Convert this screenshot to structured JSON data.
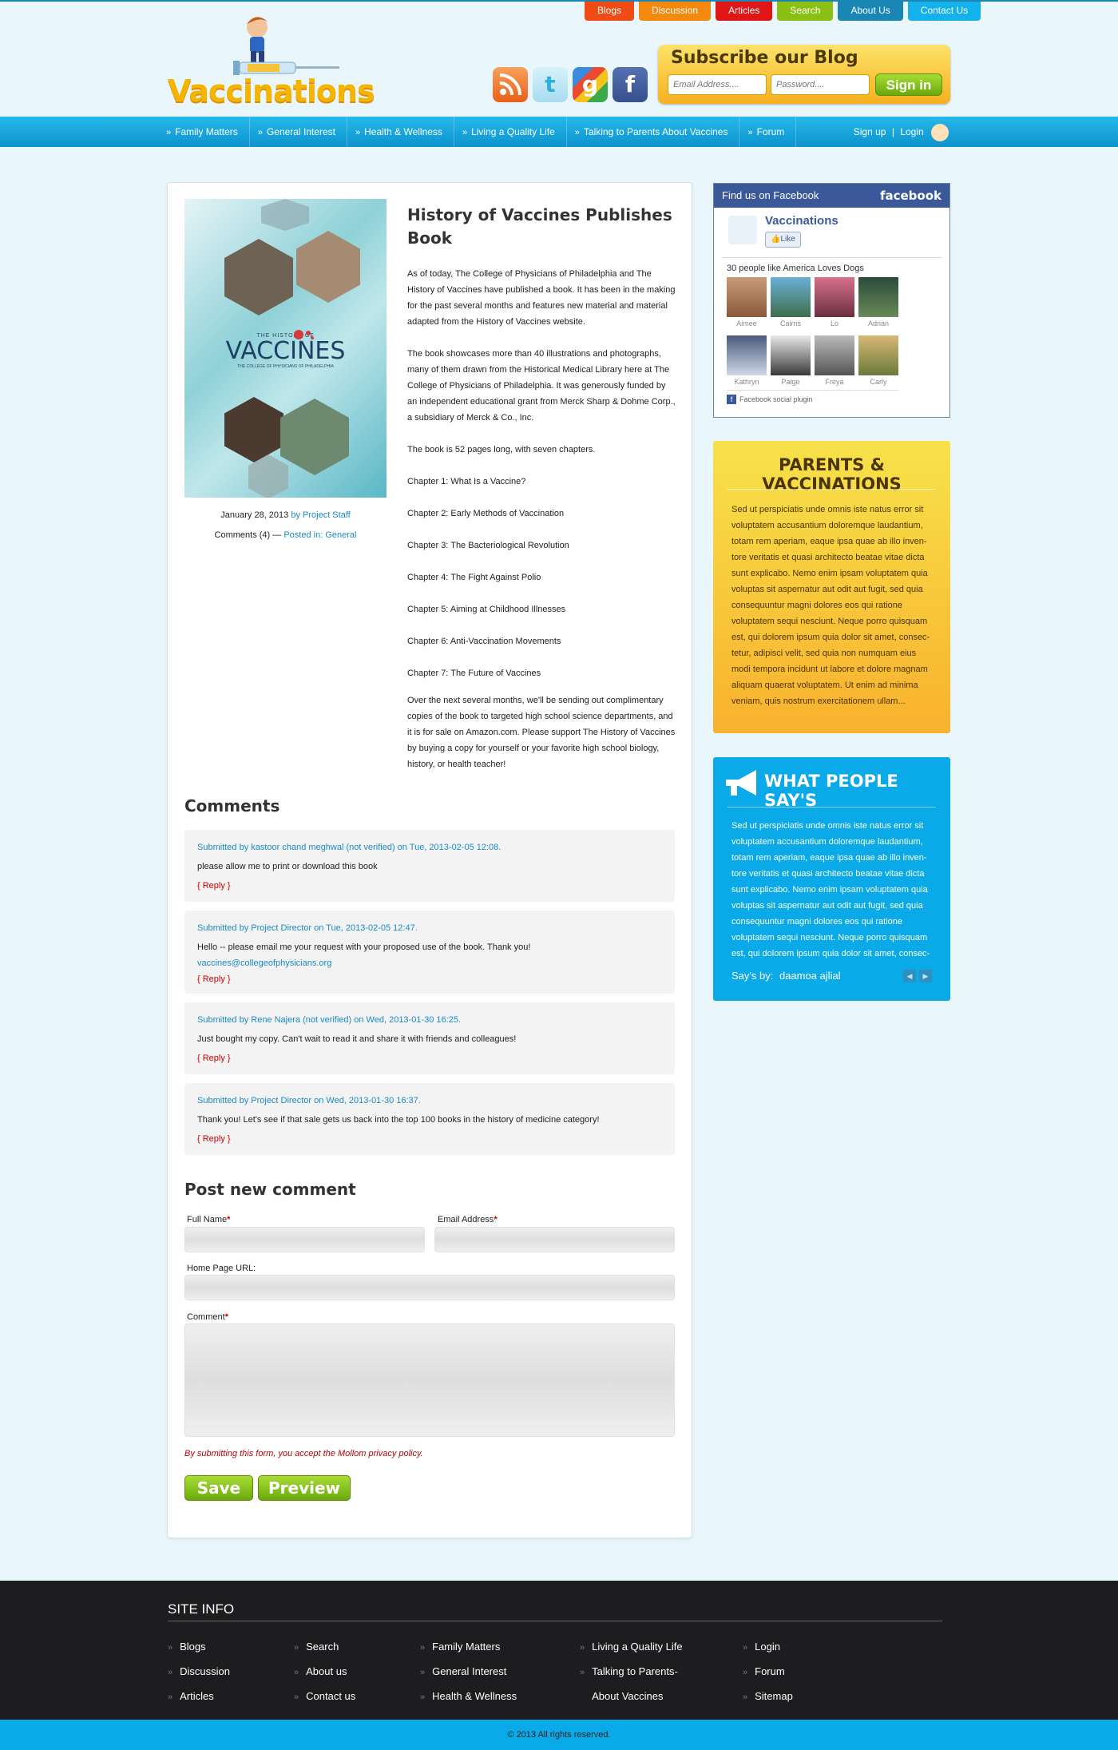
{
  "header": {
    "logo_text": "Vaccinations",
    "top_nav": [
      {
        "label": "Blogs",
        "color": "#ee4c14"
      },
      {
        "label": "Discussion",
        "color": "#f5880e"
      },
      {
        "label": "Articles",
        "color": "#e01616"
      },
      {
        "label": "Search",
        "color": "#8bbf14"
      },
      {
        "label": "About Us",
        "color": "#1a86b4"
      },
      {
        "label": "Contact Us",
        "color": "#14b2ec"
      }
    ],
    "social": [
      "rss-icon",
      "twitter-icon",
      "google-icon",
      "facebook-icon"
    ],
    "subscribe": {
      "title": "Subscribe our Blog",
      "email_placeholder": "Email Address....",
      "password_placeholder": "Password....",
      "button": "Sign in"
    }
  },
  "main_nav": {
    "items": [
      "Family Matters",
      "General Interest",
      "Health & Wellness",
      "Living a Quality Life",
      "Talking to Parents About Vaccines",
      "Forum"
    ],
    "signup": "Sign up",
    "separator": "|",
    "login": "Login"
  },
  "book": {
    "cover_title_small": "THE HISTORY OF",
    "cover_title": "VACCINES",
    "cover_subtitle": "THE COLLEGE OF PHYSICIANS OF PHILADELPHIA",
    "date": "January 28, 2013",
    "by": "by Project Staff",
    "comments_count": "Comments (4) —",
    "posted_in": "Posted in: General"
  },
  "article": {
    "title": "History of Vaccines Publishes Book",
    "p1": "As of today, The College of Physicians of Philadelphia and The History of Vaccines have published a book. It has been in the making for the past several months and features new material and material adapted from the History of Vaccines website.",
    "p2": "The book showcases more than 40 illustrations and photographs, many of them drawn from the Historical Medical Library here at The College of Physicians of Philadelphia. It was generously funded by an independent educational grant from Merck Sharp & Dohme Corp., a subsidiary of Merck & Co., Inc.",
    "p3": "The book is 52 pages long, with seven chapters.",
    "chapters": [
      "Chapter 1: What Is a Vaccine?",
      "Chapter 2: Early Methods of Vaccination",
      "Chapter 3: The Bacteriological Revolution",
      "Chapter 4: The Fight Against Polio",
      "Chapter 5: Aiming at Childhood Illnesses",
      "Chapter 6: Anti-Vaccination Movements",
      "Chapter 7: The Future of Vaccines"
    ],
    "p4": "Over the next several months, we'll be sending out complimentary copies of the book to targeted high school science departments, and it is for sale on Amazon.com. Please support The History of Vaccines by buying a copy for yourself or your favorite high school biology, history, or health teacher!"
  },
  "comments": {
    "heading": "Comments",
    "items": [
      {
        "by": "Submitted by kastoor chand meghwal (not verified) on Tue, 2013-02-05 12:08.",
        "text": "please allow me to print or download this book",
        "extra": "",
        "reply": "{ Reply }"
      },
      {
        "by": "Submitted by Project Director on Tue, 2013-02-05 12:47.",
        "text": "Hello -- please email me your request with your proposed use of the book. Thank you!",
        "extra": "vaccines@collegeofphysicians.org",
        "reply": "{ Reply }"
      },
      {
        "by": "Submitted by Rene Najera (not verified) on Wed, 2013-01-30 16:25.",
        "text": "Just bought my copy. Can't wait to read it and share it with friends and colleagues!",
        "extra": "",
        "reply": "{ Reply }"
      },
      {
        "by": "Submitted by Project Director on Wed, 2013-01-30 16:37.",
        "text": "Thank you! Let's see if that sale gets us back into the top 100 books in the history of medicine category!",
        "extra": "",
        "reply": "{ Reply }"
      }
    ]
  },
  "form": {
    "heading": "Post new comment",
    "full_name": "Full Name",
    "email": "Email Address",
    "homepage": "Home Page URL:",
    "comment": "Comment",
    "required": "*",
    "notice": "By submitting this form, you accept the Mollom privacy policy.",
    "save": "Save",
    "preview": "Preview"
  },
  "facebook": {
    "header": "Find us on Facebook",
    "brand": "facebook",
    "page_name": "Vaccinations",
    "like": "Like",
    "count_text": "30 people like America Loves Dogs",
    "people": [
      "Aimee",
      "Cairns",
      "Lo",
      "Adrian",
      "Kathryn",
      "Paige",
      "Freya",
      "Carly"
    ],
    "footer": "Facebook social plugin"
  },
  "parents": {
    "title": "PARENTS & VACCINATIONS",
    "text": "Sed ut perspiciatis unde omnis iste natus error sit voluptatem accusantium doloremque laudantium, totam rem aperiam, eaque ipsa quae ab illo inven- tore veritatis et quasi architecto beatae vitae dicta sunt explicabo. Nemo enim ipsam voluptatem quia voluptas sit aspernatur aut odit aut fugit, sed quia consequuntur magni dolores eos qui ratione voluptatem sequi nesciunt. Neque porro quisquam est, qui dolorem ipsum quia dolor sit amet, consec- tetur, adipisci velit, sed quia non numquam eius modi tempora incidunt ut labore et dolore magnam aliquam quaerat voluptatem. Ut enim ad minima veniam, quis nostrum exercitationem ullam..."
  },
  "testimonial": {
    "title": "WHAT PEOPLE SAY'S",
    "text": "Sed ut perspiciatis unde omnis iste natus error sit voluptatem accusantium doloremque laudantium, totam rem aperiam, eaque ipsa quae ab illo inven- tore veritatis et quasi architecto beatae vitae dicta sunt explicabo. Nemo enim ipsam voluptatem quia voluptas sit aspernatur aut odit aut fugit, sed quia consequuntur magni dolores eos qui ratione voluptatem sequi nesciunt. Neque porro quisquam est, qui dolorem ipsum quia dolor sit amet, consec-",
    "says_by_label": "Say's by:",
    "says_by_name": "daamoa ajlial"
  },
  "footer": {
    "heading": "SITE INFO",
    "columns": [
      [
        "Blogs",
        "Discussion",
        "Articles"
      ],
      [
        "Search",
        "About us",
        "Contact us"
      ],
      [
        "Family Matters",
        "General Interest",
        "Health & Wellness"
      ],
      [
        "Living a Quality Life",
        "Talking to Parents-",
        "About Vaccines"
      ],
      [
        "Login",
        "Forum",
        "Sitemap"
      ]
    ],
    "copyright": "© 2013 All rights reserved."
  }
}
